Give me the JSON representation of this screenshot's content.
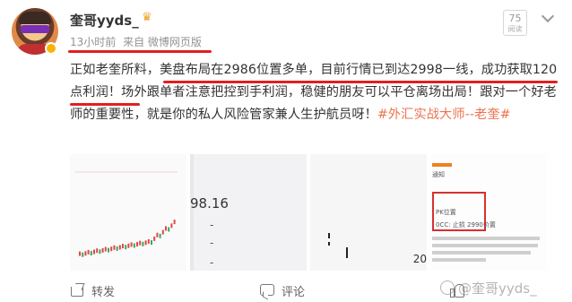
{
  "post": {
    "username": "奎哥yyds_",
    "meta_time": "13小时前",
    "meta_source": "来自 微博网页版",
    "reads_count": "75",
    "reads_label": "阅读",
    "content_text": "正如老奎所料，美盘布局在2986位置多单，目前行情已到达2998一线，成功获取120点利润！场外跟单者注意把控到手利润，稳健的朋友可以平仓离场出局！跟对一个好老师的重要性，就是你的私人风险管家兼人生护航员呀！",
    "hashtag": "#外汇实战大师--老奎#",
    "icon_names": [
      "crown-icon",
      "more-icon",
      "share-icon",
      "comment-icon",
      "like-icon",
      "weibo-logo-icon"
    ]
  },
  "images": {
    "thumb2_price": "98.16",
    "thumb2_dash1": "-",
    "thumb2_dash2": "-",
    "thumb2_dash3": "-",
    "thumb3_num": "20",
    "thumb4_t1": "通知",
    "thumb4_t2": "PK位置",
    "thumb4_t3": "0CC: 止损 2990价置"
  },
  "actions": {
    "share_label": "转发",
    "comment_label": "评论",
    "like_label": ""
  },
  "watermark": {
    "text": "@奎哥yyds_"
  }
}
